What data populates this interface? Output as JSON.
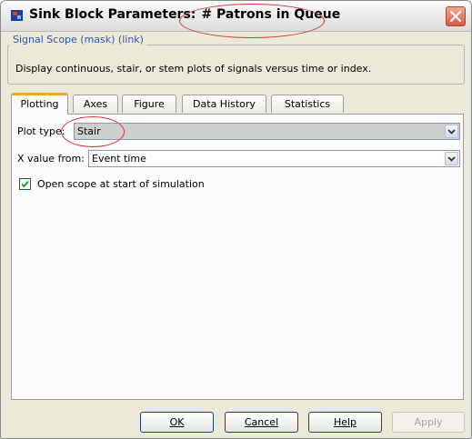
{
  "window": {
    "title_prefix": "Sink Block Parameters:",
    "title_block": "# Patrons in Queue"
  },
  "mask": {
    "legend": "Signal Scope (mask) (link)",
    "description": "Display continuous, stair, or stem plots of signals versus time or index."
  },
  "tabs": [
    "Plotting",
    "Axes",
    "Figure",
    "Data History",
    "Statistics"
  ],
  "plotting": {
    "plot_type_label": "Plot type:",
    "plot_type_value": "Stair",
    "x_value_label": "X value from:",
    "x_value_value": "Event time",
    "open_scope_label": "Open scope at start of simulation",
    "open_scope_checked": true
  },
  "buttons": {
    "ok": "OK",
    "cancel": "Cancel",
    "help": "Help",
    "apply": "Apply"
  },
  "colors": {
    "highlight": "#e03030",
    "active_tab_accent": "#f3a422",
    "legend_text": "#2a55b8"
  }
}
